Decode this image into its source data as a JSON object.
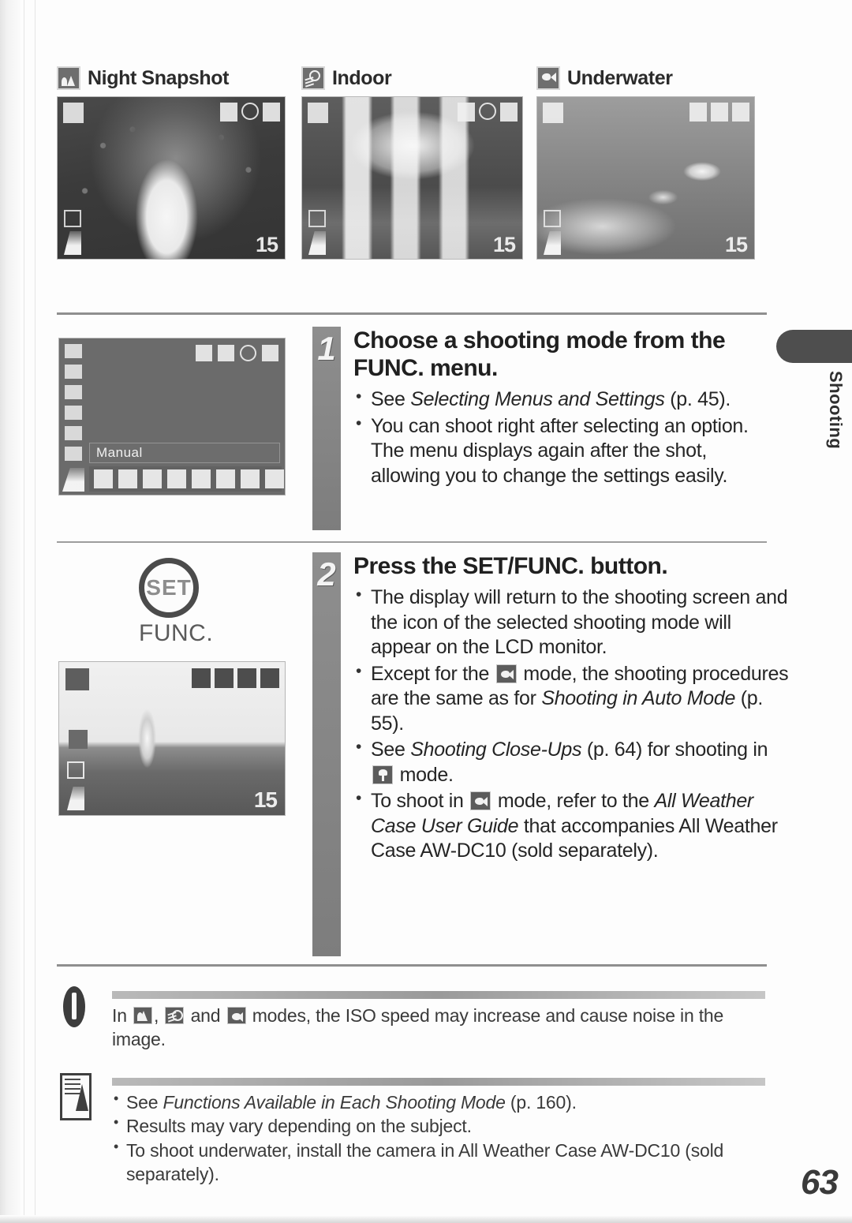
{
  "page": {
    "number": "63",
    "side_tab_label": "Shooting"
  },
  "gallery": [
    {
      "icon": "night-snapshot-icon",
      "title": "Night Snapshot",
      "lcd": {
        "shots_remaining": "15"
      }
    },
    {
      "icon": "indoor-icon",
      "title": "Indoor",
      "lcd": {
        "shots_remaining": "15"
      }
    },
    {
      "icon": "underwater-icon",
      "title": "Underwater",
      "lcd": {
        "shots_remaining": "15"
      }
    }
  ],
  "steps": [
    {
      "number": "1",
      "title": "Choose a shooting mode from the FUNC. menu.",
      "bullets": [
        {
          "parts": [
            {
              "t": "See ",
              "style": "normal"
            },
            {
              "t": "Selecting Menus and Settings",
              "style": "italic"
            },
            {
              "t": " (p. 45).",
              "style": "normal"
            }
          ]
        },
        {
          "parts": [
            {
              "t": "You can shoot right after selecting an option. The menu displays again after the shot, allowing you to change the settings easily.",
              "style": "normal"
            }
          ]
        }
      ],
      "figure": {
        "type": "func-menu-screen",
        "selected_label": "Manual"
      }
    },
    {
      "number": "2",
      "title": "Press the SET/FUNC. button.",
      "bullets": [
        {
          "parts": [
            {
              "t": "The display will return to the shooting screen and the icon of the selected shooting mode will appear on the LCD monitor.",
              "style": "normal"
            }
          ]
        },
        {
          "parts": [
            {
              "t": "Except for the ",
              "style": "normal"
            },
            {
              "t": "underwater-icon",
              "style": "glyph"
            },
            {
              "t": " mode, the shooting procedures are the same as for ",
              "style": "normal"
            },
            {
              "t": "Shooting in Auto Mode",
              "style": "italic"
            },
            {
              "t": " (p. 55).",
              "style": "normal"
            }
          ]
        },
        {
          "parts": [
            {
              "t": "See ",
              "style": "normal"
            },
            {
              "t": "Shooting Close-Ups",
              "style": "italic"
            },
            {
              "t": " (p. 64) for shooting in ",
              "style": "normal"
            },
            {
              "t": "macro-icon",
              "style": "glyph"
            },
            {
              "t": " mode.",
              "style": "normal"
            }
          ]
        },
        {
          "parts": [
            {
              "t": "To shoot in ",
              "style": "normal"
            },
            {
              "t": "underwater-icon",
              "style": "glyph"
            },
            {
              "t": " mode, refer to the ",
              "style": "normal"
            },
            {
              "t": "All Weather Case User Guide",
              "style": "italic"
            },
            {
              "t": " that accompanies All Weather Case AW-DC10 (sold separately).",
              "style": "normal"
            }
          ]
        }
      ],
      "figure": {
        "type": "set-button",
        "button_label": "SET",
        "caption": "FUNC.",
        "lcd": {
          "shots_remaining": "15"
        }
      }
    }
  ],
  "notes": {
    "warning": {
      "icon": "warning-icon",
      "parts": [
        {
          "t": "In ",
          "style": "normal"
        },
        {
          "t": "night-snapshot-icon",
          "style": "glyph"
        },
        {
          "t": ", ",
          "style": "normal"
        },
        {
          "t": "indoor-icon",
          "style": "glyph"
        },
        {
          "t": " and ",
          "style": "normal"
        },
        {
          "t": "underwater-icon",
          "style": "glyph"
        },
        {
          "t": " modes, the ISO speed may increase and cause noise in the image.",
          "style": "normal"
        }
      ]
    },
    "tips": {
      "icon": "note-pad-icon",
      "bullets": [
        {
          "parts": [
            {
              "t": "See ",
              "style": "normal"
            },
            {
              "t": "Functions Available in Each Shooting Mode",
              "style": "italic"
            },
            {
              "t": " (p. 160).",
              "style": "normal"
            }
          ]
        },
        {
          "parts": [
            {
              "t": "Results may vary depending on the subject.",
              "style": "normal"
            }
          ]
        },
        {
          "parts": [
            {
              "t": "To shoot underwater, install the camera in All Weather Case AW-DC10 (sold separately).",
              "style": "normal"
            }
          ]
        }
      ]
    }
  },
  "colors": {
    "ink": "#202020",
    "rule": "#8f8f8f",
    "step_bar": "#8e8e8e",
    "lcd_bg": "#6b6b6b",
    "tab": "#4e4e4e"
  }
}
